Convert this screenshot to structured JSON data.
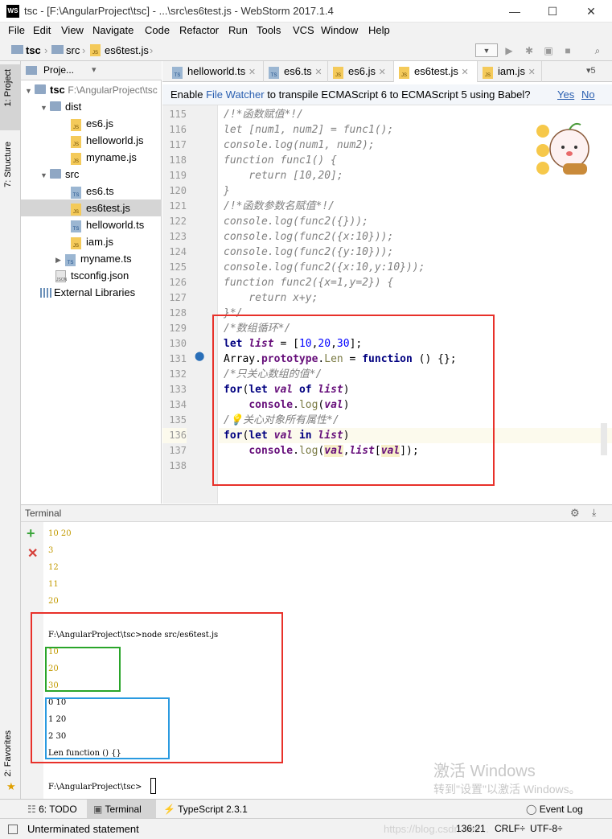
{
  "window": {
    "app_icon": "WS",
    "title": "tsc - [F:\\AngularProject\\tsc] - ...\\src\\es6test.js - WebStorm 2017.1.4",
    "minimize": "—",
    "maximize": "☐",
    "close": "✕"
  },
  "menu": [
    "File",
    "Edit",
    "View",
    "Navigate",
    "Code",
    "Refactor",
    "Run",
    "Tools",
    "VCS",
    "Window",
    "Help"
  ],
  "breadcrumbs": {
    "root": "tsc",
    "folder": "src",
    "file": "es6test.js"
  },
  "left_strip": {
    "project": "1: Project",
    "structure": "7: Structure",
    "favorites": "2: Favorites"
  },
  "project_panel": {
    "header": "Proje...",
    "tree": [
      {
        "label": "tsc",
        "path": "F:\\AngularProject\\tsc",
        "icon": "folder"
      },
      {
        "label": "dist",
        "icon": "folder"
      },
      {
        "label": "es6.js",
        "icon": "js"
      },
      {
        "label": "helloworld.js",
        "icon": "js"
      },
      {
        "label": "myname.js",
        "icon": "js"
      },
      {
        "label": "src",
        "icon": "folder"
      },
      {
        "label": "es6.ts",
        "icon": "ts"
      },
      {
        "label": "es6test.js",
        "icon": "js"
      },
      {
        "label": "helloworld.ts",
        "icon": "ts"
      },
      {
        "label": "iam.js",
        "icon": "js"
      },
      {
        "label": "myname.ts",
        "icon": "ts"
      },
      {
        "label": "tsconfig.json",
        "icon": "json"
      },
      {
        "label": "External Libraries",
        "icon": "library"
      }
    ]
  },
  "tabs": [
    "helloworld.ts",
    "es6.ts",
    "es6.js",
    "es6test.js",
    "iam.js"
  ],
  "tabs_overflow": "▾5",
  "banner": {
    "prefix": "Enable ",
    "link": "File Watcher",
    "suffix": " to transpile ECMAScript 6 to ECMAScript 5 using Babel?",
    "yes": "Yes",
    "no": "No"
  },
  "line_numbers": [
    "115",
    "116",
    "117",
    "118",
    "119",
    "120",
    "121",
    "122",
    "123",
    "124",
    "125",
    "126",
    "127",
    "128",
    "129",
    "130",
    "131",
    "132",
    "133",
    "134",
    "135",
    "136",
    "137",
    "138"
  ],
  "terminal": {
    "title": "Terminal",
    "lines": [
      "10 20",
      "3",
      "12",
      "11",
      "20",
      "",
      "F:\\AngularProject\\tsc>node src/es6test.js",
      "10",
      "20",
      "30",
      "0 10",
      "1 20",
      "2 30",
      "Len function () {}",
      "",
      "F:\\AngularProject\\tsc>"
    ]
  },
  "watermark": {
    "line1": "激活 Windows",
    "line2": "转到\"设置\"以激活 Windows。"
  },
  "bottom_tabs": {
    "todo": "6: TODO",
    "terminal": "Terminal",
    "typescript": "TypeScript 2.3.1",
    "eventlog": "Event Log"
  },
  "status": {
    "message": "Unterminated statement",
    "position": "136:21",
    "line_sep": "CRLF÷",
    "encoding": "UTF-8÷",
    "url": "https://blog.csdn.net/..."
  },
  "colors": {
    "annotation_red": "#e8312a",
    "annotation_green": "#2aa52a",
    "annotation_blue": "#2a9ae0"
  }
}
